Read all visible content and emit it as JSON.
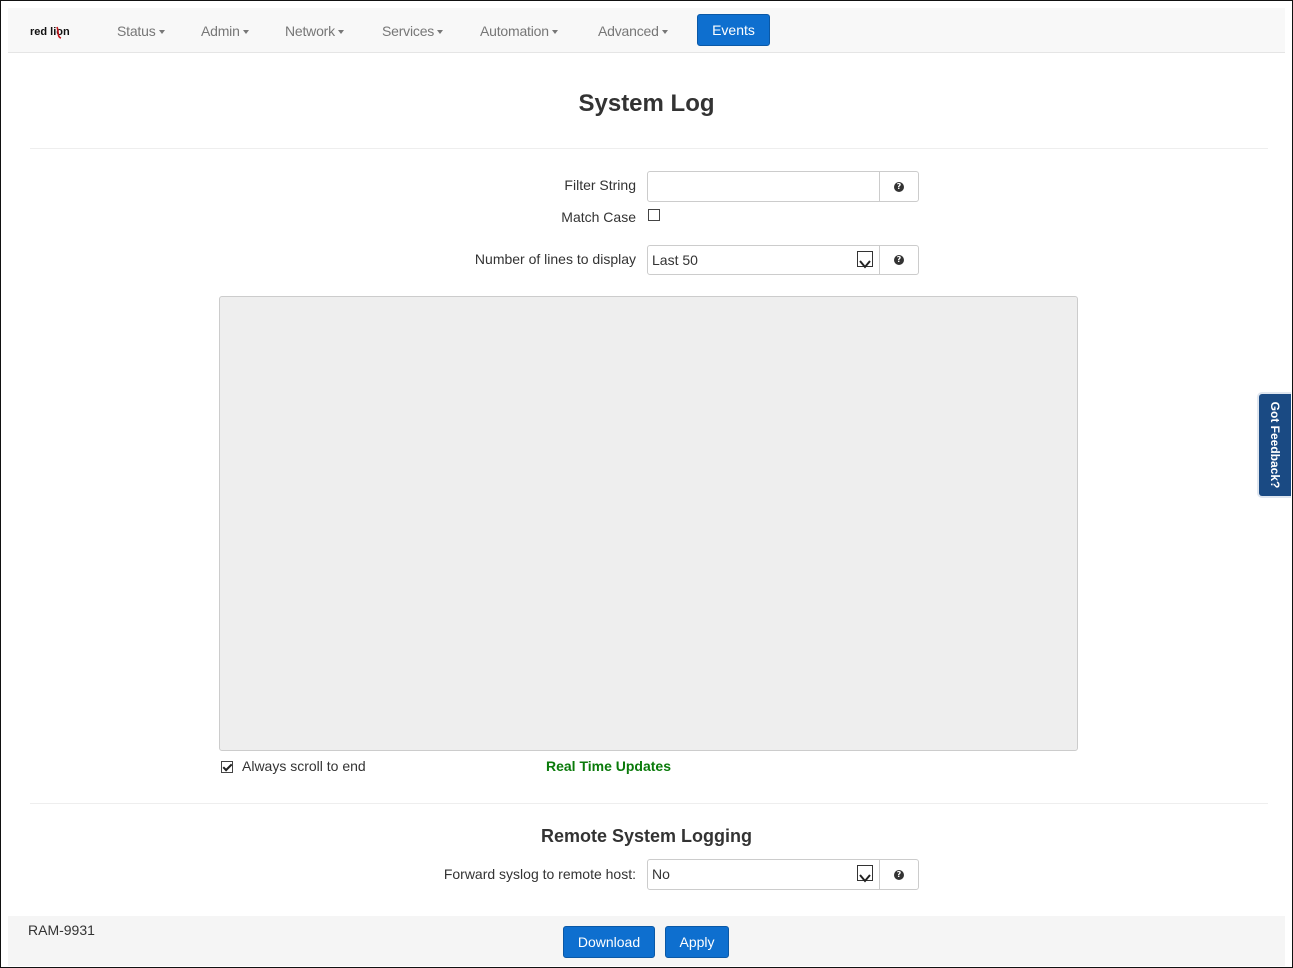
{
  "nav": {
    "logo": "red lion",
    "items": [
      "Status",
      "Admin",
      "Network",
      "Services",
      "Automation",
      "Advanced"
    ],
    "active": "Events"
  },
  "page": {
    "title": "System Log"
  },
  "filter": {
    "label": "Filter String",
    "value": "",
    "match_case_label": "Match Case",
    "match_case_checked": false
  },
  "lines": {
    "label": "Number of lines to display",
    "selected": "Last 50"
  },
  "log": {
    "always_scroll_label": "Always scroll to end",
    "always_scroll_checked": true,
    "realtime_label": "Real Time Updates"
  },
  "remote": {
    "title": "Remote System Logging",
    "forward_label": "Forward syslog to remote host:",
    "forward_selected": "No"
  },
  "footer": {
    "model": "RAM-9931",
    "download_label": "Download",
    "apply_label": "Apply"
  },
  "feedback": {
    "label": "Got Feedback?"
  },
  "colors": {
    "primary": "#0e6fcf",
    "success_text": "#0a7a0a",
    "feedback_bg": "#1a4a83"
  }
}
